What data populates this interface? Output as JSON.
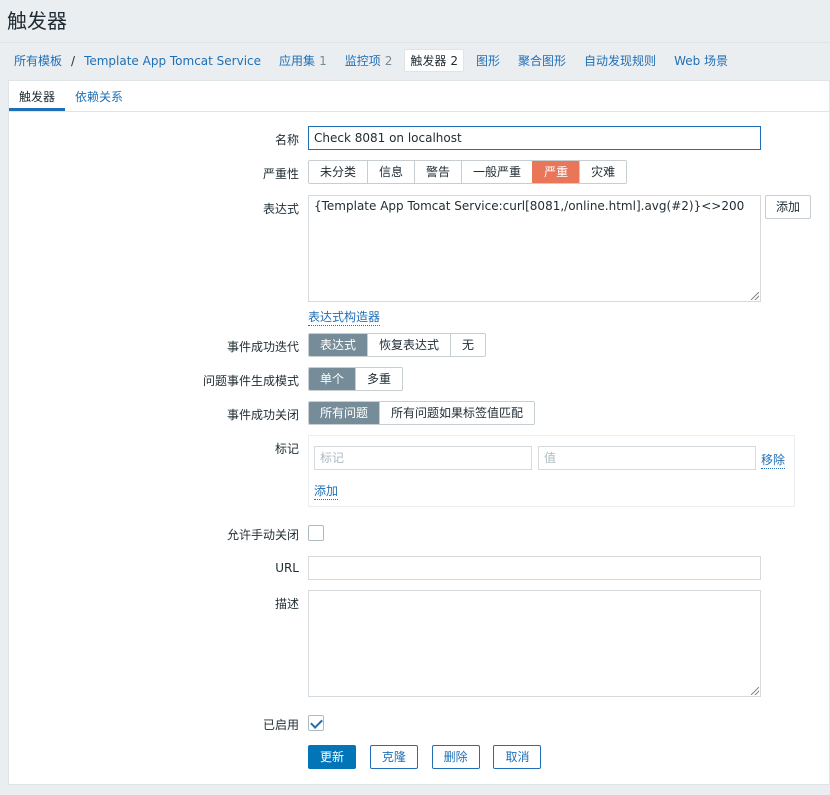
{
  "header": {
    "title": "触发器"
  },
  "nav": {
    "breadcrumb_root": "所有模板",
    "breadcrumb_sep": "/",
    "host": "Template App Tomcat Service",
    "items": [
      {
        "label": "应用集",
        "count": "1"
      },
      {
        "label": "监控项",
        "count": "2"
      },
      {
        "label": "触发器",
        "count": "2"
      },
      {
        "label": "图形",
        "count": ""
      },
      {
        "label": "聚合图形",
        "count": ""
      },
      {
        "label": "自动发现规则",
        "count": ""
      },
      {
        "label": "Web 场景",
        "count": ""
      }
    ]
  },
  "tabs": [
    "触发器",
    "依赖关系"
  ],
  "form": {
    "name_label": "名称",
    "name_value": "Check 8081 on localhost",
    "severity_label": "严重性",
    "severity_options": [
      "未分类",
      "信息",
      "警告",
      "一般严重",
      "严重",
      "灾难"
    ],
    "severity_selected": "严重",
    "expression_label": "表达式",
    "expression_value": "{Template App Tomcat Service:curl[8081,/online.html].avg(#2)}<>200",
    "expression_add": "添加",
    "expression_builder": "表达式构造器",
    "ok_event_label": "事件成功迭代",
    "ok_event_options": [
      "表达式",
      "恢复表达式",
      "无"
    ],
    "problem_mode_label": "问题事件生成模式",
    "problem_mode_options": [
      "单个",
      "多重"
    ],
    "ok_close_label": "事件成功关闭",
    "ok_close_options": [
      "所有问题",
      "所有问题如果标签值匹配"
    ],
    "tags_label": "标记",
    "tag_placeholder": "标记",
    "value_placeholder": "值",
    "tag_remove": "移除",
    "tag_add": "添加",
    "manual_close_label": "允许手动关闭",
    "url_label": "URL",
    "url_value": "",
    "description_label": "描述",
    "description_value": "",
    "enabled_label": "已启用",
    "buttons": {
      "update": "更新",
      "clone": "克隆",
      "delete": "删除",
      "cancel": "取消"
    }
  },
  "colors": {
    "accent": "#0275b8",
    "link": "#1f6fb6",
    "severity_high": "#e97659",
    "selected_seg": "#768d99"
  }
}
